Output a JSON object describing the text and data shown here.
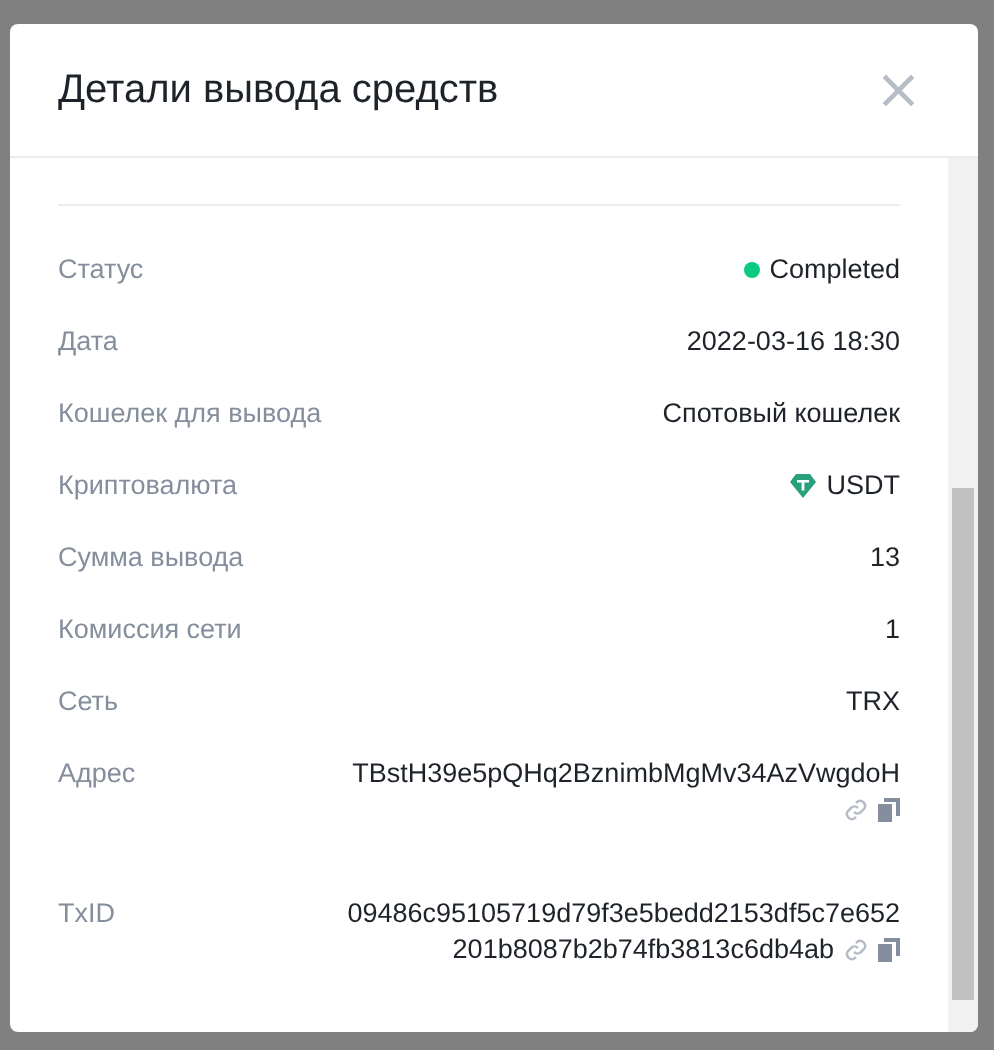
{
  "dialog": {
    "title": "Детали вывода средств",
    "close_icon": "×"
  },
  "rows": [
    {
      "kind": "status",
      "label": "Статус",
      "value": "Completed"
    },
    {
      "kind": "text",
      "label": "Дата",
      "value": "2022-03-16 18:30"
    },
    {
      "kind": "text",
      "label": "Кошелек для вывода",
      "value": "Спотовый кошелек"
    },
    {
      "kind": "coin",
      "label": "Криптовалюта",
      "value": "USDT"
    },
    {
      "kind": "text",
      "label": "Сумма вывода",
      "value": "13"
    },
    {
      "kind": "text",
      "label": "Комиссия сети",
      "value": "1"
    },
    {
      "kind": "text",
      "label": "Сеть",
      "value": "TRX"
    },
    {
      "kind": "address",
      "label": "Адрес",
      "value": "TBstH39e5pQHq2BznimbMgMv34AzVwgdoH"
    },
    {
      "kind": "address",
      "label": "TxID",
      "value": "09486c95105719d79f3e5bedd2153df5c7e652201b8087b2b74fb3813c6db4ab"
    }
  ]
}
